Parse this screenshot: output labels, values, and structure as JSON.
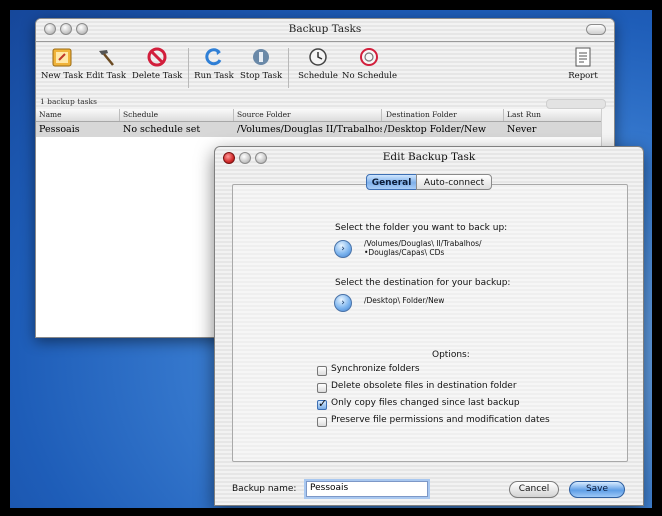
{
  "main_window": {
    "title": "Backup Tasks",
    "toolbar": [
      {
        "label": "New Task",
        "icon": "new-task-icon"
      },
      {
        "label": "Edit Task",
        "icon": "hammer-icon"
      },
      {
        "label": "Delete Task",
        "icon": "delete-icon"
      },
      {
        "label": "Run Task",
        "icon": "run-icon"
      },
      {
        "label": "Stop Task",
        "icon": "stop-icon"
      },
      {
        "label": "Schedule",
        "icon": "clock-icon"
      },
      {
        "label": "No Schedule",
        "icon": "no-schedule-icon"
      },
      {
        "label": "Report",
        "icon": "report-icon"
      }
    ],
    "status": "1 backup tasks",
    "columns": [
      "Name",
      "Schedule",
      "Source Folder",
      "Destination Folder",
      "Last Run"
    ],
    "rows": [
      {
        "name": "Pessoais",
        "schedule": "No schedule set",
        "source": "/Volumes/Douglas II/Trabalhos",
        "destination": "/Desktop Folder/New",
        "last_run": "Never"
      }
    ]
  },
  "dialog": {
    "title": "Edit Backup Task",
    "tabs": [
      "General",
      "Auto-connect"
    ],
    "active_tab": "General",
    "source_prompt": "Select the folder you want to back up:",
    "source_path_line1": "/Volumes/Douglas\\ II/Trabalhos/",
    "source_path_line2": "•Douglas/Capas\\ CDs",
    "dest_prompt": "Select the destination for your backup:",
    "dest_path": "/Desktop\\ Folder/New",
    "options_label": "Options:",
    "options": [
      {
        "label": "Synchronize folders",
        "checked": false
      },
      {
        "label": "Delete obsolete files in destination folder",
        "checked": false
      },
      {
        "label": "Only copy files changed since last backup",
        "checked": true
      },
      {
        "label": "Preserve file permissions and modification dates",
        "checked": false
      }
    ],
    "backup_name_label": "Backup name:",
    "backup_name_value": "Pessoais",
    "cancel_label": "Cancel",
    "save_label": "Save"
  }
}
